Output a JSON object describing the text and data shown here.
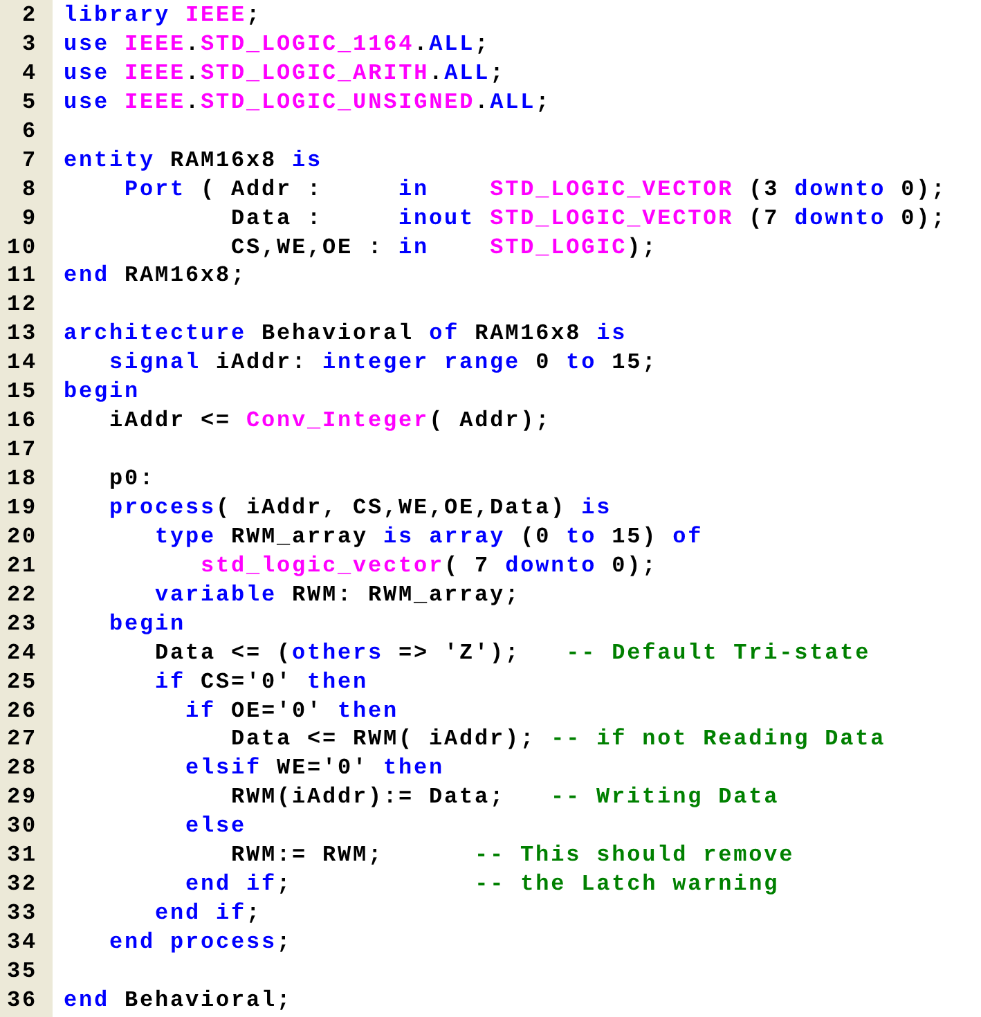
{
  "editor": {
    "lines": [
      {
        "number": "2",
        "tokens": [
          {
            "kind": "keyword",
            "text": "library"
          },
          {
            "kind": "type",
            "text": " IEEE"
          },
          {
            "kind": "plain",
            "text": ";"
          }
        ]
      },
      {
        "number": "3",
        "tokens": [
          {
            "kind": "keyword",
            "text": "use"
          },
          {
            "kind": "type",
            "text": " IEEE"
          },
          {
            "kind": "plain",
            "text": "."
          },
          {
            "kind": "type",
            "text": "STD_LOGIC_1164"
          },
          {
            "kind": "plain",
            "text": "."
          },
          {
            "kind": "keyword",
            "text": "ALL"
          },
          {
            "kind": "plain",
            "text": ";"
          }
        ]
      },
      {
        "number": "4",
        "tokens": [
          {
            "kind": "keyword",
            "text": "use"
          },
          {
            "kind": "type",
            "text": " IEEE"
          },
          {
            "kind": "plain",
            "text": "."
          },
          {
            "kind": "type",
            "text": "STD_LOGIC_ARITH"
          },
          {
            "kind": "plain",
            "text": "."
          },
          {
            "kind": "keyword",
            "text": "ALL"
          },
          {
            "kind": "plain",
            "text": ";"
          }
        ]
      },
      {
        "number": "5",
        "tokens": [
          {
            "kind": "keyword",
            "text": "use"
          },
          {
            "kind": "type",
            "text": " IEEE"
          },
          {
            "kind": "plain",
            "text": "."
          },
          {
            "kind": "type",
            "text": "STD_LOGIC_UNSIGNED"
          },
          {
            "kind": "plain",
            "text": "."
          },
          {
            "kind": "keyword",
            "text": "ALL"
          },
          {
            "kind": "plain",
            "text": ";"
          }
        ]
      },
      {
        "number": "6"
      },
      {
        "number": "7",
        "tokens": [
          {
            "kind": "keyword",
            "text": "entity"
          },
          {
            "kind": "plain",
            "text": " RAM16x8 "
          },
          {
            "kind": "keyword",
            "text": "is"
          }
        ]
      },
      {
        "number": "8",
        "tokens": [
          {
            "kind": "keyword",
            "text": "    Port"
          },
          {
            "kind": "plain",
            "text": " ( Addr :     "
          },
          {
            "kind": "keyword",
            "text": "in"
          },
          {
            "kind": "type",
            "text": "    STD_LOGIC_VECTOR"
          },
          {
            "kind": "plain",
            "text": " (3 "
          },
          {
            "kind": "keyword",
            "text": "downto"
          },
          {
            "kind": "plain",
            "text": " 0);"
          }
        ]
      },
      {
        "number": "9",
        "tokens": [
          {
            "kind": "plain",
            "text": "           Data :     "
          },
          {
            "kind": "keyword",
            "text": "inout"
          },
          {
            "kind": "type",
            "text": " STD_LOGIC_VECTOR"
          },
          {
            "kind": "plain",
            "text": " (7 "
          },
          {
            "kind": "keyword",
            "text": "downto"
          },
          {
            "kind": "plain",
            "text": " 0);"
          }
        ]
      },
      {
        "number": "10",
        "tokens": [
          {
            "kind": "plain",
            "text": "           CS,WE,OE : "
          },
          {
            "kind": "keyword",
            "text": "in"
          },
          {
            "kind": "type",
            "text": "    STD_LOGIC"
          },
          {
            "kind": "plain",
            "text": ");"
          }
        ]
      },
      {
        "number": "11",
        "tokens": [
          {
            "kind": "keyword",
            "text": "end"
          },
          {
            "kind": "plain",
            "text": " RAM16x8;"
          }
        ]
      },
      {
        "number": "12"
      },
      {
        "number": "13",
        "tokens": [
          {
            "kind": "keyword",
            "text": "architecture"
          },
          {
            "kind": "plain",
            "text": " Behavioral "
          },
          {
            "kind": "keyword",
            "text": "of"
          },
          {
            "kind": "plain",
            "text": " RAM16x8 "
          },
          {
            "kind": "keyword",
            "text": "is"
          }
        ]
      },
      {
        "number": "14",
        "tokens": [
          {
            "kind": "keyword",
            "text": "   signal"
          },
          {
            "kind": "plain",
            "text": " iAddr: "
          },
          {
            "kind": "keyword",
            "text": "integer"
          },
          {
            "kind": "keyword",
            "text": " range"
          },
          {
            "kind": "plain",
            "text": " 0 "
          },
          {
            "kind": "keyword",
            "text": "to"
          },
          {
            "kind": "plain",
            "text": " 15;"
          }
        ]
      },
      {
        "number": "15",
        "tokens": [
          {
            "kind": "keyword",
            "text": "begin"
          }
        ]
      },
      {
        "number": "16",
        "tokens": [
          {
            "kind": "plain",
            "text": "   iAddr <= "
          },
          {
            "kind": "type",
            "text": "Conv_Integer"
          },
          {
            "kind": "plain",
            "text": "( Addr);"
          }
        ]
      },
      {
        "number": "17"
      },
      {
        "number": "18",
        "tokens": [
          {
            "kind": "plain",
            "text": "   p0:"
          }
        ]
      },
      {
        "number": "19",
        "tokens": [
          {
            "kind": "keyword",
            "text": "   process"
          },
          {
            "kind": "plain",
            "text": "( iAddr, CS,WE,OE,Data) "
          },
          {
            "kind": "keyword",
            "text": "is"
          }
        ]
      },
      {
        "number": "20",
        "tokens": [
          {
            "kind": "keyword",
            "text": "      type"
          },
          {
            "kind": "plain",
            "text": " RWM_array "
          },
          {
            "kind": "keyword",
            "text": "is"
          },
          {
            "kind": "keyword",
            "text": " array"
          },
          {
            "kind": "plain",
            "text": " (0 "
          },
          {
            "kind": "keyword",
            "text": "to"
          },
          {
            "kind": "plain",
            "text": " 15) "
          },
          {
            "kind": "keyword",
            "text": "of"
          }
        ]
      },
      {
        "number": "21",
        "tokens": [
          {
            "kind": "type",
            "text": "         std_logic_vector"
          },
          {
            "kind": "plain",
            "text": "( 7 "
          },
          {
            "kind": "keyword",
            "text": "downto"
          },
          {
            "kind": "plain",
            "text": " 0);"
          }
        ]
      },
      {
        "number": "22",
        "tokens": [
          {
            "kind": "keyword",
            "text": "      variable"
          },
          {
            "kind": "plain",
            "text": " RWM: RWM_array;"
          }
        ]
      },
      {
        "number": "23",
        "tokens": [
          {
            "kind": "keyword",
            "text": "   begin"
          }
        ]
      },
      {
        "number": "24",
        "tokens": [
          {
            "kind": "plain",
            "text": "      Data <= ("
          },
          {
            "kind": "keyword",
            "text": "others"
          },
          {
            "kind": "plain",
            "text": " => 'Z');"
          },
          {
            "kind": "comment",
            "text": "   -- Default Tri-state"
          }
        ]
      },
      {
        "number": "25",
        "tokens": [
          {
            "kind": "keyword",
            "text": "      if"
          },
          {
            "kind": "plain",
            "text": " CS='0' "
          },
          {
            "kind": "keyword",
            "text": "then"
          }
        ]
      },
      {
        "number": "26",
        "tokens": [
          {
            "kind": "keyword",
            "text": "        if"
          },
          {
            "kind": "plain",
            "text": " OE='0' "
          },
          {
            "kind": "keyword",
            "text": "then"
          }
        ]
      },
      {
        "number": "27",
        "tokens": [
          {
            "kind": "plain",
            "text": "           Data <= RWM( iAddr);"
          },
          {
            "kind": "comment",
            "text": " -- if not Reading Data"
          }
        ]
      },
      {
        "number": "28",
        "tokens": [
          {
            "kind": "keyword",
            "text": "        elsif"
          },
          {
            "kind": "plain",
            "text": " WE='0' "
          },
          {
            "kind": "keyword",
            "text": "then"
          }
        ]
      },
      {
        "number": "29",
        "tokens": [
          {
            "kind": "plain",
            "text": "           RWM(iAddr):= Data;"
          },
          {
            "kind": "comment",
            "text": "   -- Writing Data"
          }
        ]
      },
      {
        "number": "30",
        "tokens": [
          {
            "kind": "keyword",
            "text": "        else"
          }
        ]
      },
      {
        "number": "31",
        "tokens": [
          {
            "kind": "plain",
            "text": "           RWM:= RWM;"
          },
          {
            "kind": "comment",
            "text": "      -- This should remove"
          }
        ]
      },
      {
        "number": "32",
        "tokens": [
          {
            "kind": "keyword",
            "text": "        end if"
          },
          {
            "kind": "plain",
            "text": ";"
          },
          {
            "kind": "comment",
            "text": "            -- the Latch warning"
          }
        ]
      },
      {
        "number": "33",
        "tokens": [
          {
            "kind": "keyword",
            "text": "      end if"
          },
          {
            "kind": "plain",
            "text": ";"
          }
        ]
      },
      {
        "number": "34",
        "tokens": [
          {
            "kind": "keyword",
            "text": "   end process"
          },
          {
            "kind": "plain",
            "text": ";"
          }
        ]
      },
      {
        "number": "35"
      },
      {
        "number": "36",
        "tokens": [
          {
            "kind": "keyword",
            "text": "end"
          },
          {
            "kind": "plain",
            "text": " Behavioral;"
          }
        ]
      }
    ]
  }
}
